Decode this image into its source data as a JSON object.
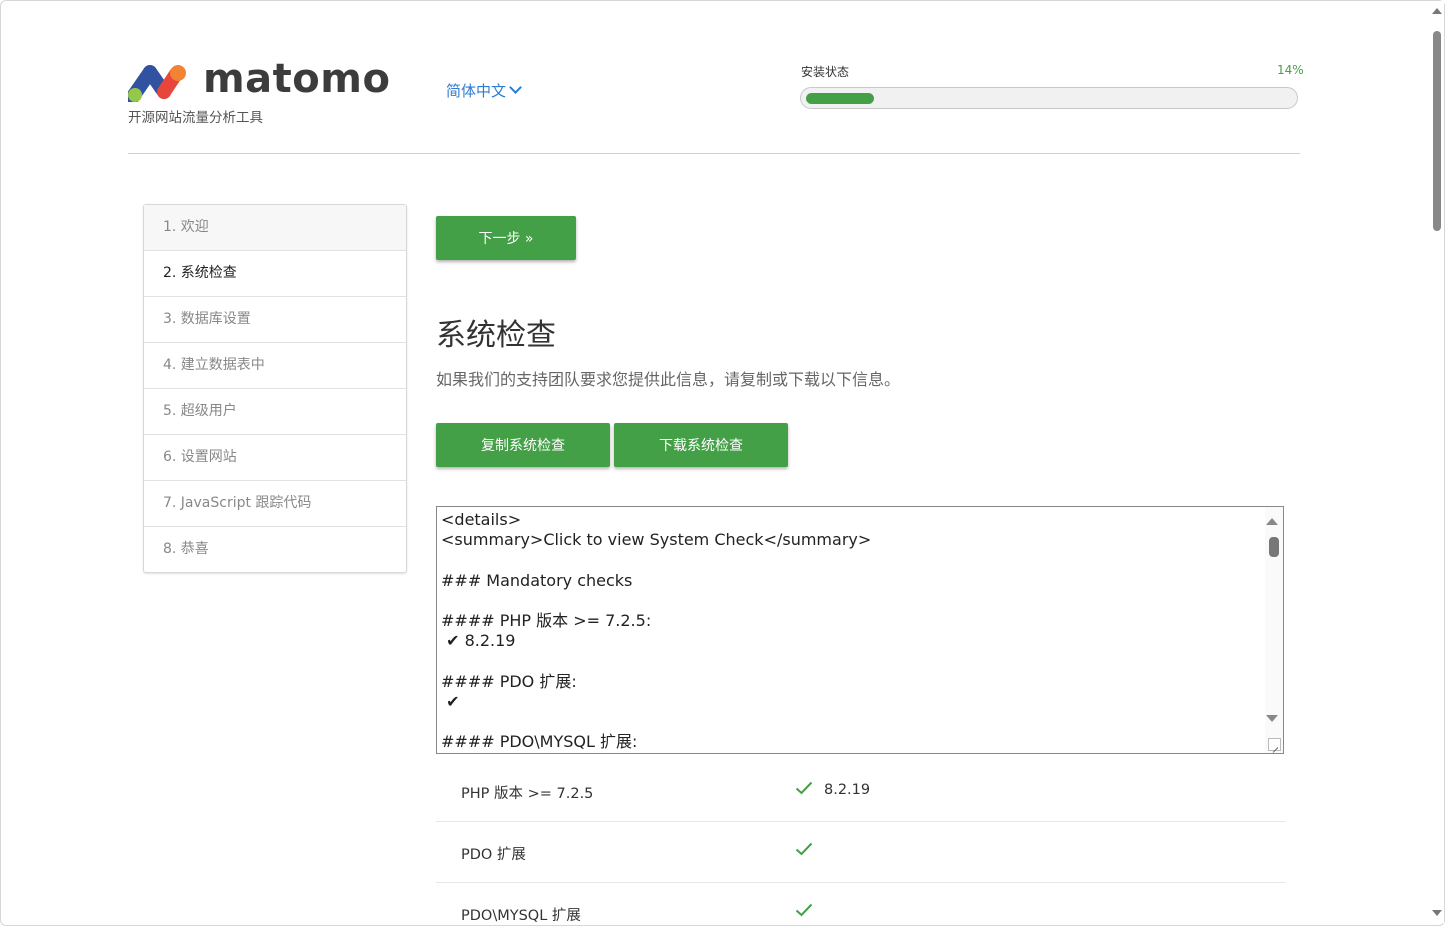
{
  "header": {
    "brand": "matomo",
    "tagline": "开源网站流量分析工具",
    "language": "简体中文",
    "progress_label": "安装状态",
    "progress_text": "14%",
    "progress_value": 0.14
  },
  "steps": [
    {
      "label": "1. 欢迎",
      "state": "done"
    },
    {
      "label": "2. 系统检查",
      "state": "active"
    },
    {
      "label": "3. 数据库设置",
      "state": "todo"
    },
    {
      "label": "4. 建立数据表中",
      "state": "todo"
    },
    {
      "label": "5. 超级用户",
      "state": "todo"
    },
    {
      "label": "6. 设置网站",
      "state": "todo"
    },
    {
      "label": "7. JavaScript 跟踪代码",
      "state": "todo"
    },
    {
      "label": "8. 恭喜",
      "state": "todo"
    }
  ],
  "main": {
    "next_button": "下一步 »",
    "title": "系统检查",
    "subtitle": "如果我们的支持团队要求您提供此信息，请复制或下载以下信息。",
    "copy_button": "复制系统检查",
    "download_button": "下载系统检查",
    "system_check_text": "<details>\n<summary>Click to view System Check</summary>\n\n### Mandatory checks\n\n#### PHP 版本 >= 7.2.5:\n ✔ 8.2.19\n\n#### PDO 扩展:\n ✔\n\n#### PDO\\MYSQL 扩展:"
  },
  "checks": [
    {
      "name": "PHP 版本 >= 7.2.5",
      "status": "ok",
      "value": "8.2.19"
    },
    {
      "name": "PDO 扩展",
      "status": "ok",
      "value": ""
    },
    {
      "name": "PDO\\MYSQL 扩展",
      "status": "ok",
      "value": ""
    }
  ],
  "colors": {
    "accent": "#43a047",
    "link": "#2c7cd4"
  },
  "icons": {
    "check": "check-icon",
    "language_dropdown": "chevron-down-icon"
  }
}
